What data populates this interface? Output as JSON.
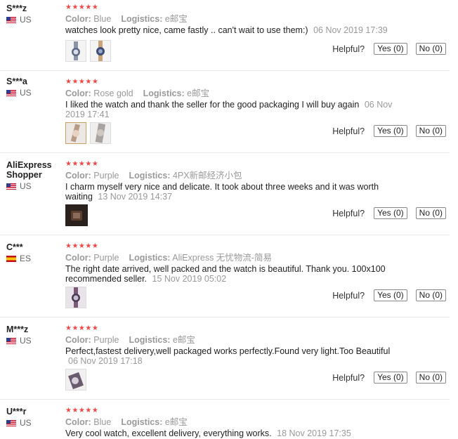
{
  "reviews": [
    {
      "username": "S***z",
      "country": "US",
      "stars": "★★★★★",
      "color_label": "Color:",
      "color": "Blue",
      "logistics_label": "Logistics:",
      "logistics": "e邮宝",
      "text": "watches look pretty nice, came fastly .. can't wait to use them:)",
      "date": "06 Nov 2019 17:39",
      "helpful_label": "Helpful?",
      "yes_label": "Yes (0)",
      "no_label": "No (0)"
    },
    {
      "username": "S***a",
      "country": "US",
      "stars": "★★★★★",
      "color_label": "Color:",
      "color": "Rose gold",
      "logistics_label": "Logistics:",
      "logistics": "e邮宝",
      "text": "I liked the watch and thank the seller for the good packaging I will buy again",
      "date": "06 Nov 2019 17:41",
      "helpful_label": "Helpful?",
      "yes_label": "Yes (0)",
      "no_label": "No (0)"
    },
    {
      "username": "AliExpress Shopper",
      "country": "US",
      "stars": "★★★★★",
      "color_label": "Color:",
      "color": "Purple",
      "logistics_label": "Logistics:",
      "logistics": "4PX新邮经济小包",
      "text": "I charm myself very nice and delicate. It took about three weeks and it was worth waiting",
      "date": "13 Nov 2019 14:37",
      "helpful_label": "Helpful?",
      "yes_label": "Yes (0)",
      "no_label": "No (0)"
    },
    {
      "username": "C***",
      "country": "ES",
      "stars": "★★★★★",
      "color_label": "Color:",
      "color": "Purple",
      "logistics_label": "Logistics:",
      "logistics": "AliExpress 无忧物流-简易",
      "text": "The right date arrived, well packed and the watch is beautiful. Thank you. 100x100 recommended seller.",
      "date": "15 Nov 2019 05:02",
      "helpful_label": "Helpful?",
      "yes_label": "Yes (0)",
      "no_label": "No (0)"
    },
    {
      "username": "M***z",
      "country": "US",
      "stars": "★★★★★",
      "color_label": "Color:",
      "color": "Purple",
      "logistics_label": "Logistics:",
      "logistics": "e邮宝",
      "text": "Perfect,fastest delivery,well packaged works perfectly.Found very light.Too Beautiful",
      "date": "06 Nov 2019 17:18",
      "helpful_label": "Helpful?",
      "yes_label": "Yes (0)",
      "no_label": "No (0)"
    },
    {
      "username": "U***r",
      "country": "US",
      "stars": "★★★★★",
      "color_label": "Color:",
      "color": "Blue",
      "logistics_label": "Logistics:",
      "logistics": "e邮宝",
      "text": "Very cool watch, excellent delivery, everything works.",
      "date": "18 Nov 2019 17:35"
    }
  ]
}
